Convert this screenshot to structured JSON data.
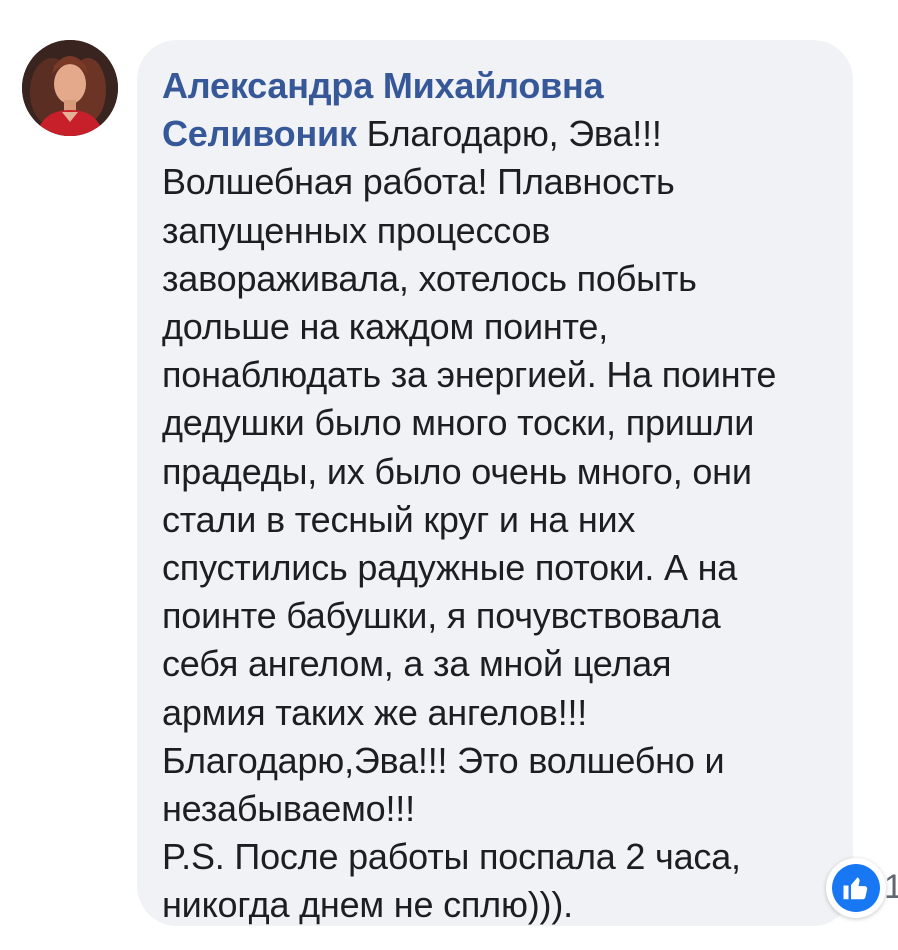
{
  "comment": {
    "author": "Александра Михайловна Селивоник",
    "lines": [
      "Благодарю, Эва!!!",
      "Волшебная работа! Плавность",
      "запущенных процессов",
      "завораживала, хотелось побыть",
      "дольше на каждом поинте,",
      "понаблюдать за энергией. На поинте",
      "дедушки было много тоски, пришли",
      "прадеды, их было очень много, они",
      "стали в тесный круг и на них",
      "спустились радужные потоки. А на",
      "поинте бабушки, я почувствовала",
      "себя ангелом, а за мной целая",
      "армия таких же ангелов!!!",
      "Благодарю,Эва!!! Это волшебно и",
      "незабываемо!!!",
      "P.S. После работы поспала 2 часа,",
      "никогда днем не сплю)))."
    ]
  },
  "reactions": {
    "icon": "like-icon",
    "count": "1"
  },
  "colors": {
    "author": "#365899",
    "bubble": "#f0f2f5",
    "like": "#1877f2",
    "text": "#1c1e21"
  }
}
